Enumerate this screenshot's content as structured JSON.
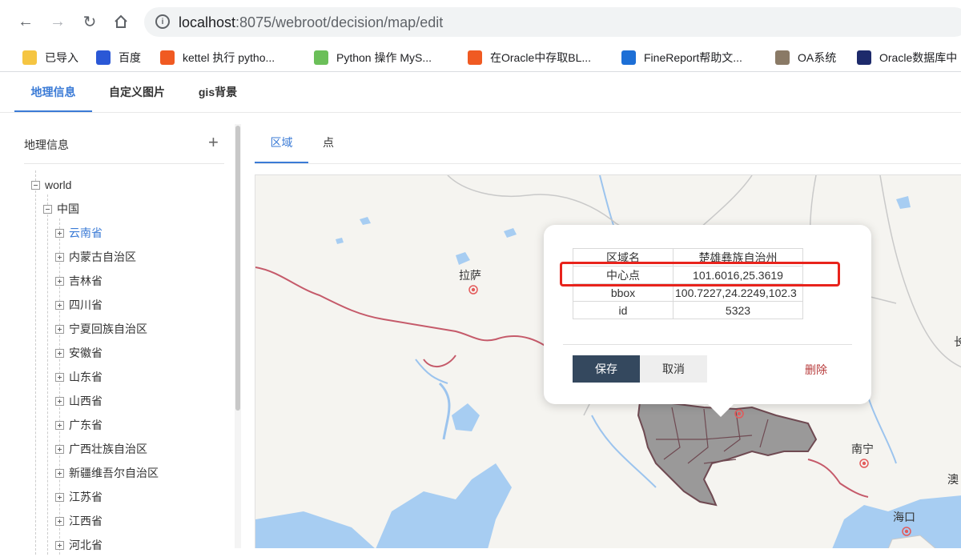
{
  "browser": {
    "url_host": "localhost",
    "url_rest": ":8075/webroot/decision/map/edit",
    "bookmarks": [
      {
        "label": "已导入",
        "icon": "folder-icon",
        "color": "#f5c542"
      },
      {
        "label": "百度",
        "icon": "baidu-paw-icon",
        "color": "#2b58d6"
      },
      {
        "label": "kettel 执行 pytho...",
        "icon": "csdn-c-icon",
        "color": "#f05a22"
      },
      {
        "label": "Python 操作 MyS...",
        "icon": "code-icon",
        "color": "#6bbf59"
      },
      {
        "label": "在Oracle中存取BL...",
        "icon": "csdn-c-icon",
        "color": "#f05a22"
      },
      {
        "label": "FineReport帮助文...",
        "icon": "finereport-icon",
        "color": "#1d6fd6"
      },
      {
        "label": "OA系统",
        "icon": "oa-image-icon",
        "color": "#8a7a66"
      },
      {
        "label": "Oracle数据库中",
        "icon": "oracle-db-icon",
        "color": "#1d2a6b"
      }
    ]
  },
  "app": {
    "tabs": [
      "地理信息",
      "自定义图片",
      "gis背景"
    ],
    "active_tab": "地理信息"
  },
  "sidebar": {
    "title": "地理信息",
    "tree": {
      "root": "world",
      "country": "中国",
      "provinces": [
        "云南省",
        "内蒙古自治区",
        "吉林省",
        "四川省",
        "宁夏回族自治区",
        "安徽省",
        "山东省",
        "山西省",
        "广东省",
        "广西壮族自治区",
        "新疆维吾尔自治区",
        "江苏省",
        "江西省",
        "河北省"
      ],
      "selected": "云南省"
    }
  },
  "subtabs": [
    "区域",
    "点"
  ],
  "map": {
    "labels": {
      "lhasa": "拉萨",
      "nanning": "南宁",
      "haikou": "海口",
      "edge_right_1": "长",
      "edge_right_2": "澳"
    }
  },
  "popup": {
    "rows": [
      {
        "key": "区域名",
        "value": "楚雄彝族自治州"
      },
      {
        "key": "中心点",
        "value": "101.6016,25.3619"
      },
      {
        "key": "bbox",
        "value": "100.7227,24.2249,102.3"
      },
      {
        "key": "id",
        "value": "5323"
      }
    ],
    "save": "保存",
    "cancel": "取消",
    "delete": "删除"
  }
}
